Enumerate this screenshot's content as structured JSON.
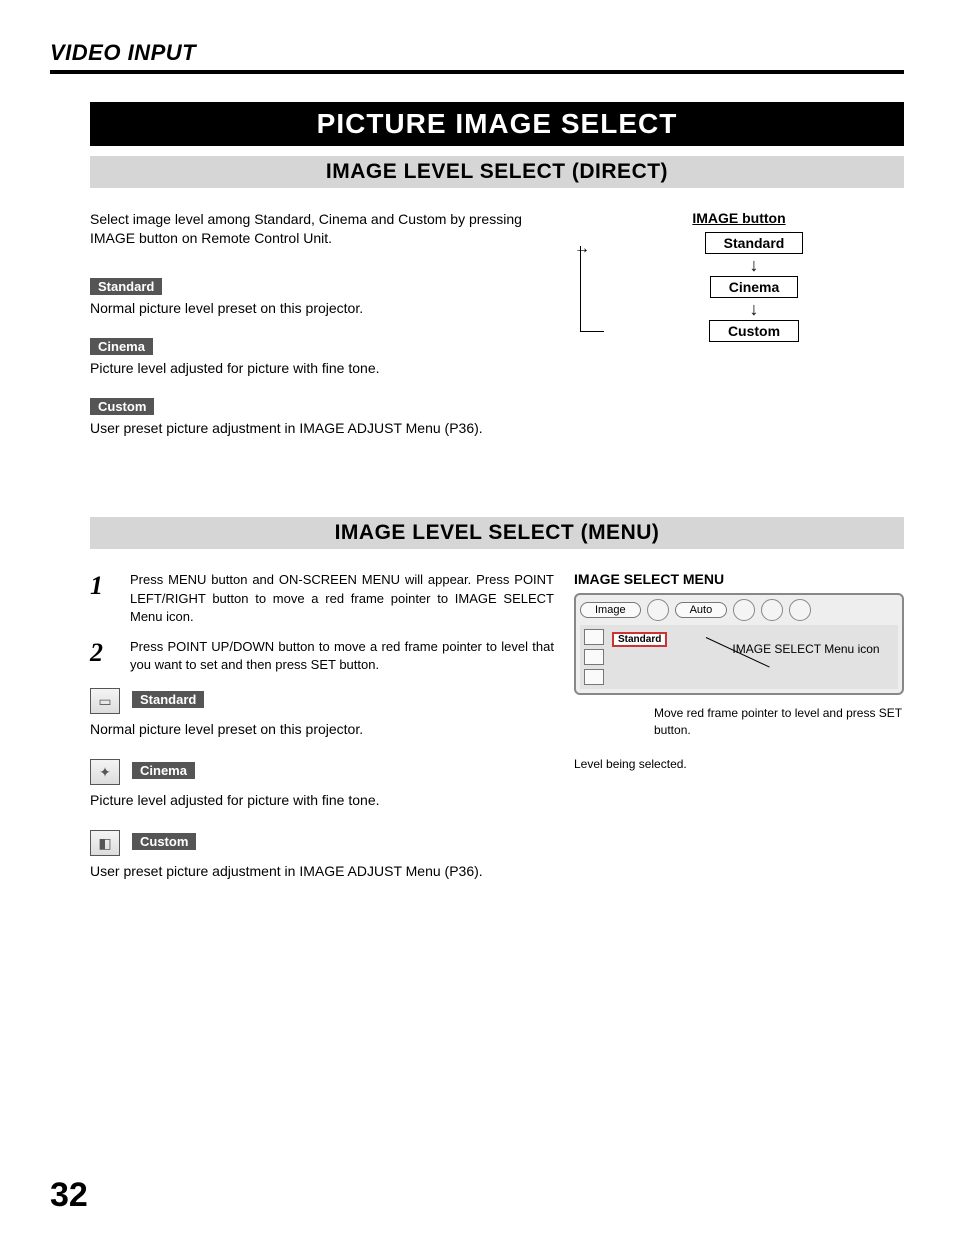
{
  "header": "VIDEO INPUT",
  "page_number": "32",
  "title_bar": "PICTURE IMAGE SELECT",
  "section1": {
    "heading": "IMAGE LEVEL SELECT (DIRECT)",
    "intro": "Select image level among Standard, Cinema and Custom by pressing IMAGE button on Remote Control Unit.",
    "modes": [
      {
        "label": "Standard",
        "desc": "Normal picture level preset on this projector."
      },
      {
        "label": "Cinema",
        "desc": "Picture level adjusted for picture with fine tone."
      },
      {
        "label": "Custom",
        "desc": "User preset picture adjustment in IMAGE ADJUST Menu (P36)."
      }
    ],
    "diagram": {
      "title": "IMAGE button",
      "items": [
        "Standard",
        "Cinema",
        "Custom"
      ]
    }
  },
  "section2": {
    "heading": "IMAGE LEVEL SELECT (MENU)",
    "steps": [
      {
        "num": "1",
        "text": "Press MENU button and ON-SCREEN MENU will appear.  Press POINT LEFT/RIGHT button to move a red frame pointer to IMAGE SELECT Menu icon."
      },
      {
        "num": "2",
        "text": "Press POINT UP/DOWN button to move a red frame pointer to level that you want to set and then press SET button."
      }
    ],
    "modes": [
      {
        "label": "Standard",
        "desc": "Normal picture level preset on this projector."
      },
      {
        "label": "Cinema",
        "desc": "Picture level adjusted for picture with fine tone."
      },
      {
        "label": "Custom",
        "desc": "User preset picture adjustment in IMAGE ADJUST Menu (P36)."
      }
    ],
    "menu": {
      "title": "IMAGE SELECT MENU",
      "tab_label": "Image",
      "mode_label": "Auto",
      "selected": "Standard",
      "callout_icon": "IMAGE SELECT Menu icon",
      "callout_mid": "Move red frame pointer to level and press SET button.",
      "callout_bot": "Level being selected."
    }
  }
}
